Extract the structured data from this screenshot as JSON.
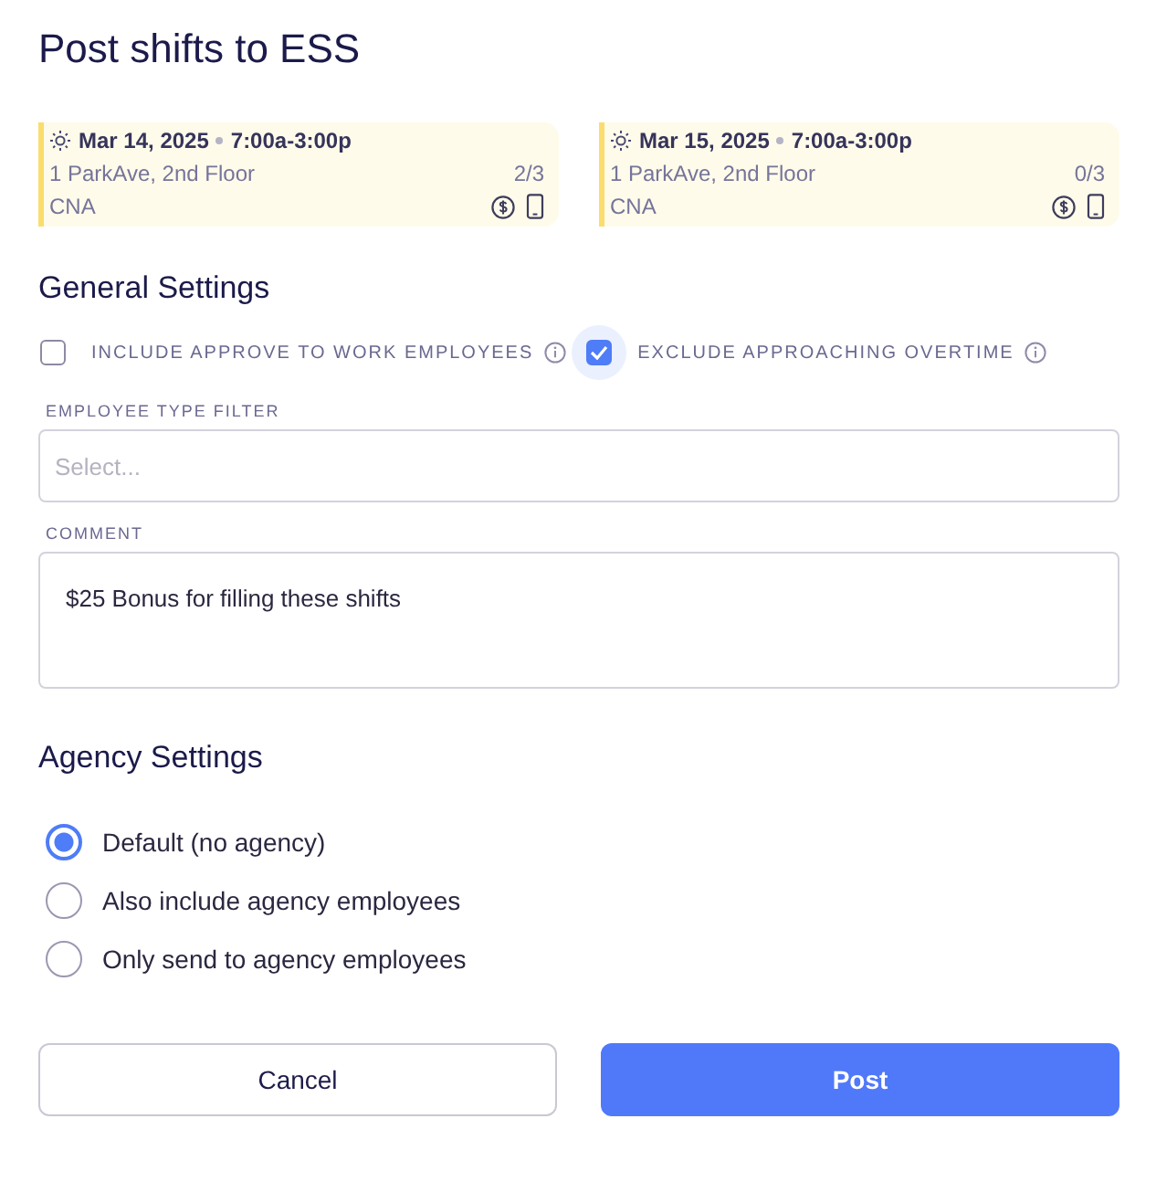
{
  "title": "Post shifts to ESS",
  "shifts": [
    {
      "date": "Mar 14, 2025",
      "time": "7:00a-3:00p",
      "location": "1 ParkAve, 2nd Floor",
      "count": "2/3",
      "role": "CNA"
    },
    {
      "date": "Mar 15, 2025",
      "time": "7:00a-3:00p",
      "location": "1 ParkAve, 2nd Floor",
      "count": "0/3",
      "role": "CNA"
    }
  ],
  "general_settings": {
    "heading": "General Settings",
    "checkboxes": [
      {
        "label": "INCLUDE APPROVE TO WORK EMPLOYEES",
        "checked": false
      },
      {
        "label": "EXCLUDE APPROACHING OVERTIME",
        "checked": true
      }
    ],
    "employee_type_filter": {
      "label": "EMPLOYEE TYPE FILTER",
      "placeholder": "Select..."
    },
    "comment": {
      "label": "COMMENT",
      "value": "$25 Bonus for filling these shifts"
    }
  },
  "agency_settings": {
    "heading": "Agency Settings",
    "options": [
      {
        "label": "Default (no agency)",
        "selected": true
      },
      {
        "label": "Also include agency employees",
        "selected": false
      },
      {
        "label": "Only send to agency employees",
        "selected": false
      }
    ]
  },
  "buttons": [
    {
      "label": "Cancel",
      "kind": "secondary"
    },
    {
      "label": "Post",
      "kind": "primary"
    }
  ]
}
